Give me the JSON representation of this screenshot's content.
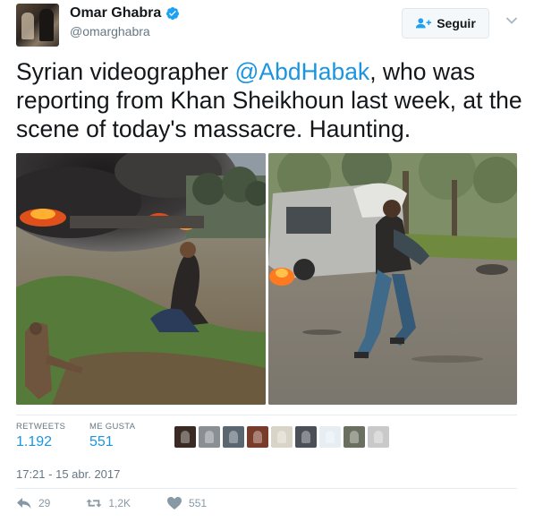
{
  "author": {
    "display_name": "Omar Ghabra",
    "handle": "@omarghabra",
    "verified_icon": "verified-badge-icon"
  },
  "follow_button": {
    "label": "Seguir",
    "icon": "add-user-icon"
  },
  "tweet": {
    "text_before": "Syrian videographer ",
    "mention": "@AbdHabak",
    "text_after": ", who was reporting from Khan Sheikhoun last week, at the scene of today's massacre. Haunting."
  },
  "stats": {
    "retweets_label": "RETWEETS",
    "retweets_value": "1.192",
    "likes_label": "ME GUSTA",
    "likes_value": "551"
  },
  "timestamp": "17:21 - 15 abr. 2017",
  "actions": {
    "reply_count": "29",
    "retweet_count": "1,2K",
    "like_count": "551"
  },
  "colors": {
    "link": "#1b95e0",
    "secondary_text": "#657786",
    "action_gray": "#8899a6",
    "verified": "#1da1f2"
  }
}
